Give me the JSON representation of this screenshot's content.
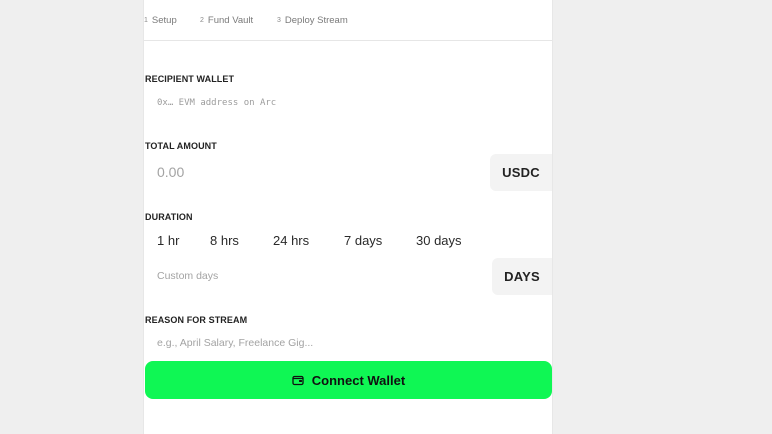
{
  "steps": [
    {
      "num": "1",
      "label": "Setup"
    },
    {
      "num": "2",
      "label": "Fund Vault"
    },
    {
      "num": "3",
      "label": "Deploy Stream"
    }
  ],
  "recipient": {
    "label": "RECIPIENT WALLET",
    "placeholder": "0x… EVM address on Arc"
  },
  "amount": {
    "label": "TOTAL AMOUNT",
    "placeholder": "0.00",
    "unit": "USDC"
  },
  "duration": {
    "label": "DURATION",
    "options": [
      "1 hr",
      "8 hrs",
      "24 hrs",
      "7 days",
      "30 days"
    ],
    "custom_placeholder": "Custom days",
    "custom_unit": "DAYS"
  },
  "reason": {
    "label": "REASON FOR STREAM",
    "placeholder": "e.g., April Salary, Freelance Gig..."
  },
  "cta": {
    "label": "Connect Wallet",
    "icon": "wallet-icon",
    "color": "#0ff754"
  }
}
